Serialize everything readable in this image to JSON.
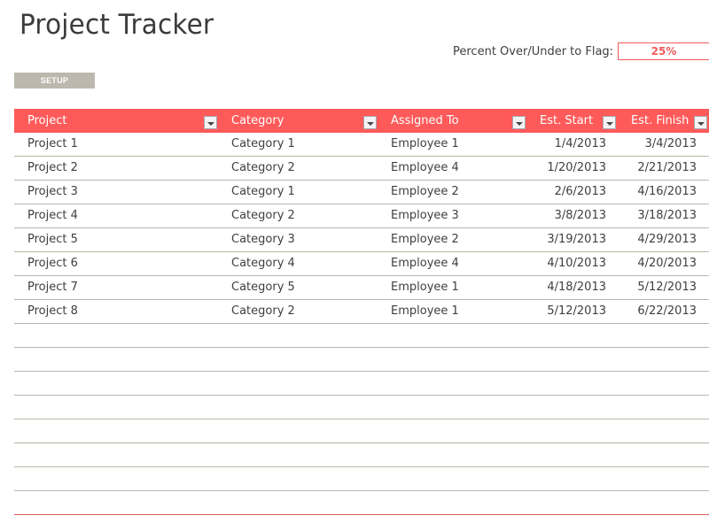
{
  "title": "Project Tracker",
  "flag": {
    "label": "Percent Over/Under to Flag:",
    "value": "25%"
  },
  "setup_button": "SETUP",
  "colors": {
    "header_bg": "#ff5a5a",
    "accent": "#f05a5a",
    "setup_bg": "#bcb8ae",
    "row_border": "#bab5aa"
  },
  "table": {
    "columns": [
      {
        "label": "Project",
        "icon": "dropdown-filter-icon"
      },
      {
        "label": "Category",
        "icon": "dropdown-filter-icon"
      },
      {
        "label": "Assigned To",
        "icon": "dropdown-filter-icon"
      },
      {
        "label": "Est. Start",
        "icon": "dropdown-filter-icon"
      },
      {
        "label": "Est. Finish",
        "icon": "dropdown-filter-icon"
      }
    ],
    "rows": [
      [
        "Project 1",
        "Category 1",
        "Employee 1",
        "1/4/2013",
        "3/4/2013"
      ],
      [
        "Project 2",
        "Category 2",
        "Employee 4",
        "1/20/2013",
        "2/21/2013"
      ],
      [
        "Project 3",
        "Category 1",
        "Employee 2",
        "2/6/2013",
        "4/16/2013"
      ],
      [
        "Project 4",
        "Category 2",
        "Employee 3",
        "3/8/2013",
        "3/18/2013"
      ],
      [
        "Project 5",
        "Category 3",
        "Employee 2",
        "3/19/2013",
        "4/29/2013"
      ],
      [
        "Project 6",
        "Category 4",
        "Employee 4",
        "4/10/2013",
        "4/20/2013"
      ],
      [
        "Project 7",
        "Category 5",
        "Employee 1",
        "4/18/2013",
        "5/12/2013"
      ],
      [
        "Project 8",
        "Category 2",
        "Employee 1",
        "5/12/2013",
        "6/22/2013"
      ]
    ]
  }
}
